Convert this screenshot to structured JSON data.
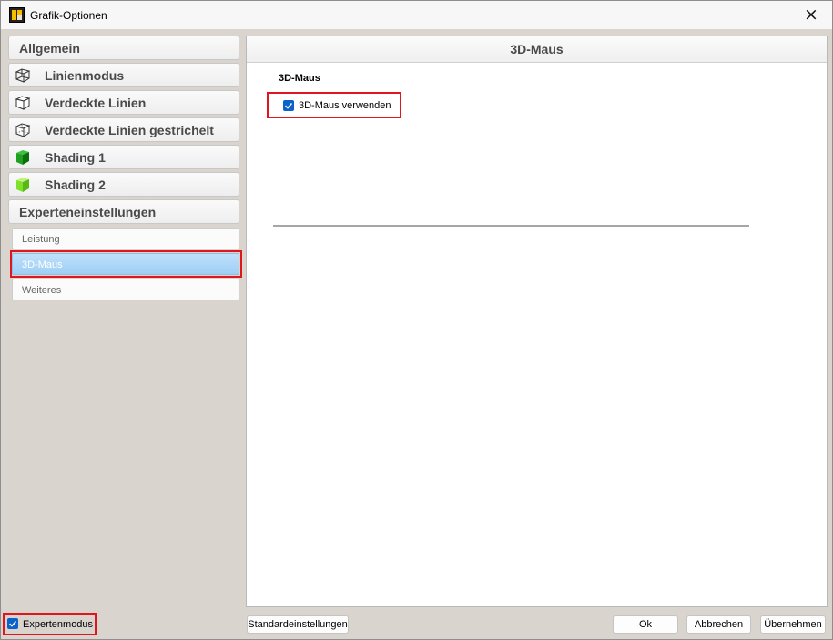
{
  "window": {
    "title": "Grafik-Optionen",
    "close_icon": "×"
  },
  "sidebar": {
    "categories": [
      {
        "label": "Allgemein",
        "icon": ""
      },
      {
        "label": "Linienmodus",
        "icon": "wireframe-cube-icon"
      },
      {
        "label": "Verdeckte Linien",
        "icon": "hidden-lines-cube-icon"
      },
      {
        "label": "Verdeckte Linien gestrichelt",
        "icon": "dashed-hidden-lines-cube-icon"
      },
      {
        "label": "Shading 1",
        "icon": "green-shaded-cube-icon"
      },
      {
        "label": "Shading 2",
        "icon": "lime-shaded-cube-icon"
      },
      {
        "label": "Experteneinstellungen",
        "icon": ""
      }
    ],
    "subitems": [
      {
        "label": "Leistung",
        "active": false
      },
      {
        "label": "3D-Maus",
        "active": true
      },
      {
        "label": "Weiteres",
        "active": false
      }
    ]
  },
  "panel": {
    "header": "3D-Maus",
    "section_title": "3D-Maus",
    "checkbox": {
      "label": "3D-Maus verwenden",
      "checked": true
    }
  },
  "footer": {
    "expert_mode": {
      "label": "Expertenmodus",
      "checked": true
    },
    "defaults_button": "Standardeinstellungen",
    "ok_button": "Ok",
    "cancel_button": "Abbrechen",
    "apply_button": "Übernehmen"
  },
  "colors": {
    "accent": "#0a63c8",
    "highlight_border": "#e0161c",
    "active_item": "#9ecff5",
    "shading1": "#1fa01f",
    "shading2": "#7ee02a"
  }
}
